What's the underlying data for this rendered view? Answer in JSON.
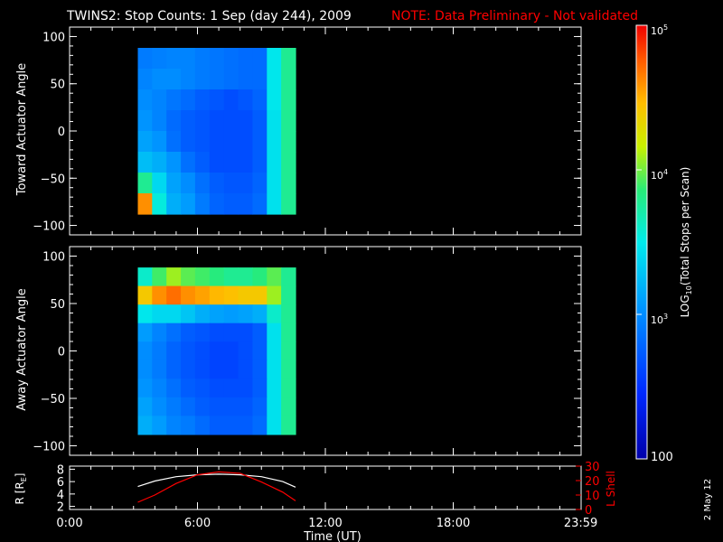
{
  "header": {
    "title": "TWINS2: Stop Counts:  1 Sep (day 244), 2009",
    "note": "NOTE: Data Preliminary - Not validated"
  },
  "footer": {
    "date_stamp": "2 May 12"
  },
  "colorbar": {
    "label": "LOG10(Total Stops per Scan)",
    "label_main": "LOG",
    "label_sub": "10",
    "label_rest": "(Total Stops per Scan)",
    "tick_labels": [
      "10^5",
      "10^4",
      "10^3",
      "100"
    ],
    "tick_base": "10",
    "tick_exps": [
      "5",
      "4",
      "3"
    ],
    "tick_bottom": "100",
    "range": [
      100,
      100000
    ],
    "scale": "log"
  },
  "chart_data": [
    {
      "type": "heatmap",
      "panel": "toward",
      "ylabel": "Toward Actuator Angle",
      "ylim": [
        -110,
        110
      ],
      "yticks": [
        "100",
        "50",
        "0",
        "−50",
        "−100"
      ],
      "xlim_hours": [
        0,
        24
      ],
      "data_x_hours": [
        3.2,
        10.6
      ],
      "data_y": [
        -88,
        88
      ],
      "rows": [
        {
          "y": 88,
          "values": [
            800,
            850,
            900,
            900,
            800,
            750,
            700,
            650,
            650,
            3000,
            6000
          ]
        },
        {
          "y": 65,
          "values": [
            900,
            1000,
            1000,
            900,
            800,
            750,
            700,
            650,
            650,
            3000,
            6000
          ]
        },
        {
          "y": 40,
          "values": [
            1000,
            900,
            750,
            650,
            550,
            500,
            450,
            500,
            600,
            3000,
            6000
          ]
        },
        {
          "y": 15,
          "values": [
            1100,
            900,
            650,
            550,
            500,
            450,
            450,
            450,
            550,
            2800,
            6000
          ]
        },
        {
          "y": -10,
          "values": [
            1300,
            1100,
            700,
            550,
            500,
            450,
            450,
            450,
            550,
            2800,
            6000
          ]
        },
        {
          "y": -35,
          "values": [
            1800,
            1500,
            1100,
            700,
            550,
            450,
            450,
            450,
            550,
            2800,
            6000
          ]
        },
        {
          "y": -60,
          "values": [
            6000,
            2500,
            1300,
            1000,
            700,
            550,
            500,
            500,
            600,
            2800,
            6000
          ]
        },
        {
          "y": -85,
          "values": [
            40000,
            3500,
            1500,
            1200,
            800,
            600,
            550,
            550,
            650,
            2800,
            6000
          ]
        }
      ]
    },
    {
      "type": "heatmap",
      "panel": "away",
      "ylabel": "Away Actuator Angle",
      "ylim": [
        -110,
        110
      ],
      "yticks": [
        "100",
        "50",
        "0",
        "−50",
        "−100"
      ],
      "xlim_hours": [
        0,
        24
      ],
      "data_x_hours": [
        3.2,
        10.6
      ],
      "data_y": [
        -88,
        88
      ],
      "rows": [
        {
          "y": 88,
          "values": [
            4000,
            8000,
            12000,
            9000,
            8000,
            7000,
            6000,
            6000,
            7000,
            9000,
            6000
          ]
        },
        {
          "y": 75,
          "values": [
            25000,
            40000,
            50000,
            40000,
            35000,
            30000,
            28000,
            25000,
            25000,
            12000,
            6000
          ]
        },
        {
          "y": 60,
          "values": [
            3000,
            2500,
            2500,
            2000,
            1500,
            1300,
            1200,
            1300,
            1500,
            4000,
            6000
          ]
        },
        {
          "y": 40,
          "values": [
            1200,
            900,
            700,
            550,
            500,
            450,
            450,
            450,
            550,
            2800,
            6000
          ]
        },
        {
          "y": 15,
          "values": [
            1000,
            800,
            600,
            500,
            450,
            400,
            400,
            450,
            550,
            2800,
            6000
          ]
        },
        {
          "y": -10,
          "values": [
            1000,
            800,
            600,
            500,
            450,
            400,
            400,
            450,
            550,
            2800,
            6000
          ]
        },
        {
          "y": -35,
          "values": [
            1100,
            900,
            700,
            550,
            500,
            450,
            450,
            450,
            550,
            2800,
            6000
          ]
        },
        {
          "y": -60,
          "values": [
            1300,
            1000,
            800,
            650,
            550,
            500,
            500,
            500,
            600,
            2800,
            6000
          ]
        },
        {
          "y": -85,
          "values": [
            1500,
            1200,
            900,
            800,
            650,
            550,
            550,
            550,
            650,
            2800,
            6000
          ]
        }
      ]
    },
    {
      "type": "line",
      "panel": "orbit",
      "ylabel_main": "R [R",
      "ylabel_sub": "E",
      "ylabel_end": "]",
      "ylabel": "R [RE]",
      "y2label": "L Shell",
      "xlabel": "Time (UT)",
      "xtick_labels": [
        "0:00",
        "6:00",
        "12:00",
        "18:00",
        "23:59"
      ],
      "xticks_hours": [
        0,
        6,
        12,
        18,
        23.983
      ],
      "xlim_hours": [
        0,
        24
      ],
      "ylim": [
        1.5,
        8.5
      ],
      "yticks": [
        "8",
        "6",
        "4",
        "2"
      ],
      "y2lim": [
        0,
        30
      ],
      "y2ticks": [
        "30",
        "20",
        "10",
        "0"
      ],
      "series": [
        {
          "name": "R",
          "color": "#ffffff",
          "axis": "left",
          "x": [
            3.2,
            4,
            5,
            6,
            7,
            8,
            9,
            10,
            10.6
          ],
          "y": [
            5.2,
            6.1,
            6.8,
            7.1,
            7.2,
            7.1,
            6.8,
            6.0,
            5.1
          ]
        },
        {
          "name": "L Shell",
          "color": "#ff0000",
          "axis": "right",
          "x": [
            3.2,
            4,
            5,
            6,
            7,
            8,
            9,
            10,
            10.6
          ],
          "y": [
            5,
            10,
            18,
            24,
            26,
            25,
            19,
            12,
            6
          ]
        }
      ]
    }
  ]
}
